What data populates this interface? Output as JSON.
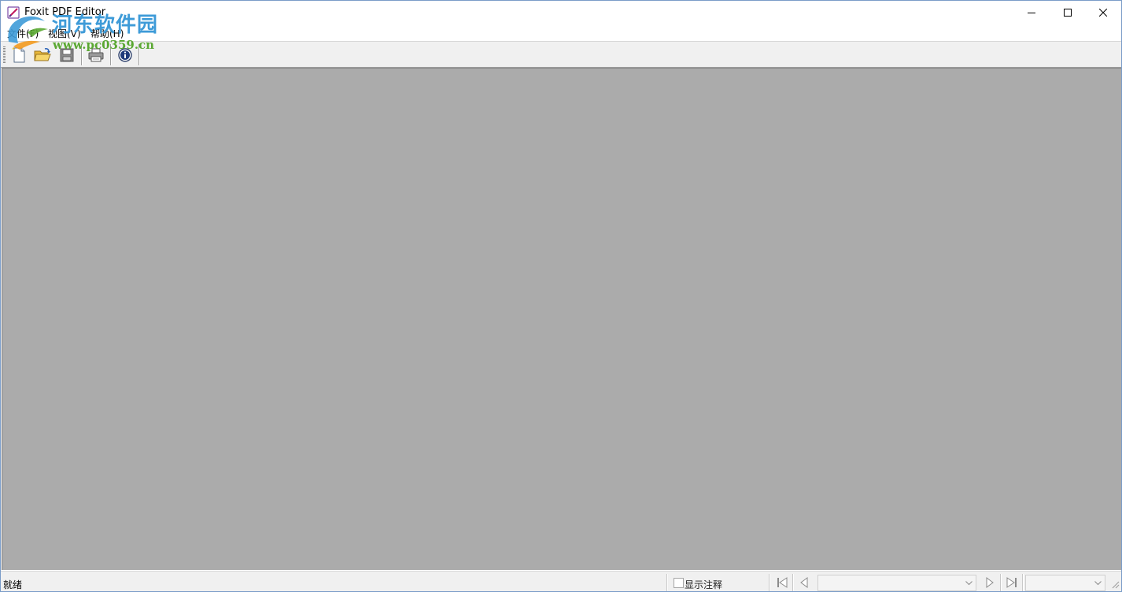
{
  "window": {
    "title": "Foxit PDF Editor",
    "controls": {
      "minimize": "minimize",
      "maximize": "maximize",
      "close": "close"
    }
  },
  "menu": [
    {
      "label": "文件(F)"
    },
    {
      "label": "视图(V)"
    },
    {
      "label": "帮助(H)"
    }
  ],
  "watermark": {
    "title": "河东软件园",
    "url": "www.pc0359.cn"
  },
  "toolbar": {
    "buttons": [
      {
        "icon": "new-document-icon",
        "tooltip": ""
      },
      {
        "icon": "open-folder-icon",
        "tooltip": ""
      },
      {
        "icon": "save-disk-icon",
        "tooltip": ""
      },
      {
        "icon": "printer-icon",
        "tooltip": ""
      },
      {
        "icon": "info-icon",
        "tooltip": ""
      }
    ]
  },
  "workspace": {
    "background": "#ababab"
  },
  "statusbar": {
    "status": "就绪",
    "show_annotations_label": "显示注释",
    "show_annotations_checked": false,
    "page_combo_value": "",
    "zoom_combo_value": ""
  },
  "colors": {
    "workspace": "#ababab",
    "chrome": "#f0f0f0",
    "watermark_blue": "#3e9bd8",
    "watermark_green": "#5aa832"
  }
}
